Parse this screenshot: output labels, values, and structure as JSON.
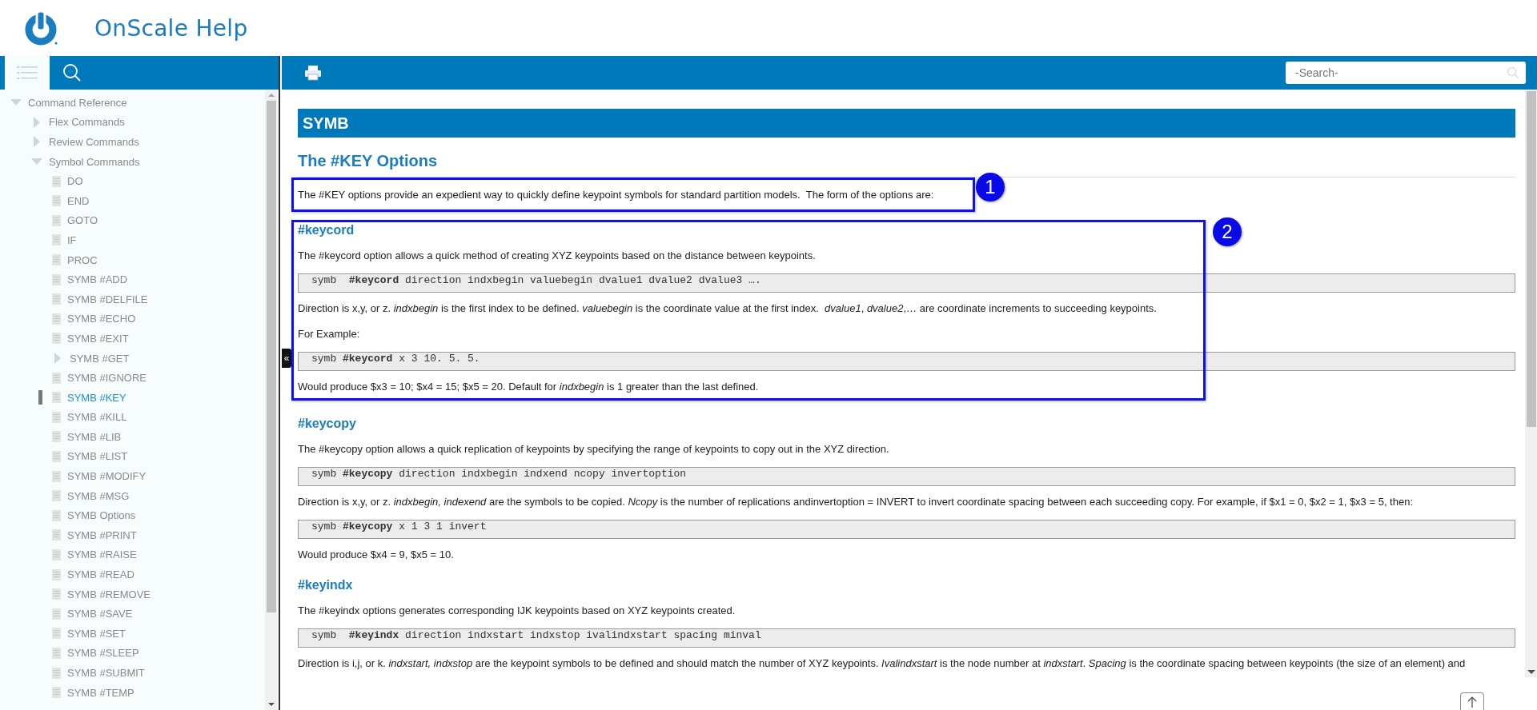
{
  "header": {
    "title": "OnScale Help"
  },
  "sidebar": {
    "tabs": [
      {
        "kind": "contents",
        "selected": true
      },
      {
        "kind": "search",
        "selected": false
      }
    ],
    "tree": [
      {
        "label": "Command Reference",
        "kind": "folder",
        "expanded": true,
        "selected": false,
        "children": [
          {
            "label": "Flex Commands",
            "kind": "folder",
            "expanded": false,
            "selected": false
          },
          {
            "label": "Review Commands",
            "kind": "folder",
            "expanded": false,
            "selected": false
          },
          {
            "label": "Symbol Commands",
            "kind": "folder",
            "expanded": true,
            "selected": false,
            "children": [
              {
                "label": "DO",
                "kind": "page",
                "selected": false
              },
              {
                "label": "END",
                "kind": "page",
                "selected": false
              },
              {
                "label": "GOTO",
                "kind": "page",
                "selected": false
              },
              {
                "label": "IF",
                "kind": "page",
                "selected": false
              },
              {
                "label": "PROC",
                "kind": "page",
                "selected": false
              },
              {
                "label": "SYMB #ADD",
                "kind": "page",
                "selected": false
              },
              {
                "label": "SYMB #DELFILE",
                "kind": "page",
                "selected": false
              },
              {
                "label": "SYMB #ECHO",
                "kind": "page",
                "selected": false
              },
              {
                "label": "SYMB #EXIT",
                "kind": "page",
                "selected": false
              },
              {
                "label": "SYMB #GET",
                "kind": "folder",
                "expanded": false,
                "selected": false
              },
              {
                "label": "SYMB #IGNORE",
                "kind": "page",
                "selected": false
              },
              {
                "label": "SYMB #KEY",
                "kind": "page",
                "selected": true
              },
              {
                "label": "SYMB #KILL",
                "kind": "page",
                "selected": false
              },
              {
                "label": "SYMB #LIB",
                "kind": "page",
                "selected": false
              },
              {
                "label": "SYMB #LIST",
                "kind": "page",
                "selected": false
              },
              {
                "label": "SYMB #MODIFY",
                "kind": "page",
                "selected": false
              },
              {
                "label": "SYMB #MSG",
                "kind": "page",
                "selected": false
              },
              {
                "label": "SYMB Options",
                "kind": "page",
                "selected": false
              },
              {
                "label": "SYMB #PRINT",
                "kind": "page",
                "selected": false
              },
              {
                "label": "SYMB #RAISE",
                "kind": "page",
                "selected": false
              },
              {
                "label": "SYMB #READ",
                "kind": "page",
                "selected": false
              },
              {
                "label": "SYMB #REMOVE",
                "kind": "page",
                "selected": false
              },
              {
                "label": "SYMB #SAVE",
                "kind": "page",
                "selected": false
              },
              {
                "label": "SYMB #SET",
                "kind": "page",
                "selected": false
              },
              {
                "label": "SYMB #SLEEP",
                "kind": "page",
                "selected": false
              },
              {
                "label": "SYMB #SUBMIT",
                "kind": "page",
                "selected": false
              },
              {
                "label": "SYMB #TEMP",
                "kind": "page",
                "selected": false
              }
            ]
          }
        ]
      }
    ]
  },
  "toolbar": {
    "search": {
      "placeholder": "-Search-"
    }
  },
  "collapse_handle": "«",
  "article": {
    "title": "SYMB",
    "heading": "The #KEY Options",
    "sections": [
      {
        "annotation": "1",
        "blocks": [
          {
            "kind": "paragraph",
            "text": "The #KEY options provide an expedient way to quickly define keypoint symbols for standard partition models.  The form of the options are:"
          }
        ]
      },
      {
        "annotation": "2",
        "blocks": [
          {
            "kind": "subheading",
            "text": "#keycord"
          },
          {
            "kind": "paragraph",
            "text": "The #keycord option allows a quick method of creating XYZ keypoints based on the distance between keypoints."
          },
          {
            "kind": "code",
            "text": "symb  **#keycord** direction indxbegin valuebegin dvalue1 dvalue2 dvalue3 …."
          },
          {
            "kind": "paragraph",
            "text": "Direction is x,y, or z. *indxbegin* is the first index to be defined. *valuebegin* is the coordinate value at the first index.  *dvalue1*, *dvalue2*,… are coordinate increments to succeeding keypoints."
          },
          {
            "kind": "paragraph",
            "text": "For Example:"
          },
          {
            "kind": "code",
            "text": "symb **#keycord** x 3 10. 5. 5."
          },
          {
            "kind": "paragraph",
            "text": "Would produce $x3 = 10; $x4 = 15; $x5 = 20. Default for *indxbegin* is 1 greater than the last defined."
          }
        ]
      },
      {
        "blocks": [
          {
            "kind": "subheading",
            "text": "#keycopy"
          },
          {
            "kind": "paragraph",
            "text": "The #keycopy option allows a quick replication of keypoints by specifying the range of keypoints to copy out in the XYZ direction."
          },
          {
            "kind": "code",
            "text": "symb **#keycopy** direction indxbegin indxend ncopy invertoption"
          },
          {
            "kind": "paragraph",
            "text": "Direction is x,y, or z. *indxbegin, indexend* are the symbols to be copied. *Ncopy* is the number of replications andinvertoption = INVERT to invert coordinate spacing between each succeeding copy. For example, if $x1 = 0, $x2 = 1, $x3 = 5, then:"
          },
          {
            "kind": "code",
            "text": "symb **#keycopy** x 1 3 1 invert"
          },
          {
            "kind": "paragraph",
            "text": "Would produce $x4 = 9, $x5 = 10."
          },
          {
            "kind": "subheading",
            "text": "#keyindx"
          },
          {
            "kind": "paragraph",
            "text": "The #keyindx options generates corresponding IJK keypoints based on XYZ keypoints created."
          },
          {
            "kind": "code",
            "text": "symb  **#keyindx** direction indxstart indxstop ivalindxstart spacing minval"
          },
          {
            "kind": "paragraph",
            "text": "Direction is i,j, or k. *indxstart, indxstop* are the keypoint symbols to be defined and should match the number of XYZ keypoints. *Ivalindxstart* is the node number at *indxstart*. *Spacing* is the coordinate spacing between keypoints (the size of an element) and"
          }
        ]
      }
    ]
  }
}
